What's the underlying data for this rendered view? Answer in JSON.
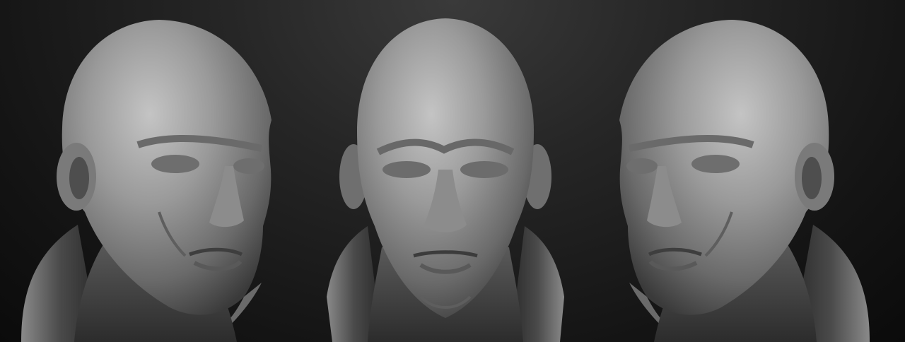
{
  "scene": {
    "background_top": "#3a3a3a",
    "background_bottom": "#0b0b0b",
    "material_light": "#b9b9b9",
    "material_mid": "#7d7d7d",
    "material_dark": "#3c3c3c"
  },
  "views": [
    {
      "name": "three-quarter-right-view"
    },
    {
      "name": "front-view"
    },
    {
      "name": "three-quarter-left-view"
    }
  ]
}
